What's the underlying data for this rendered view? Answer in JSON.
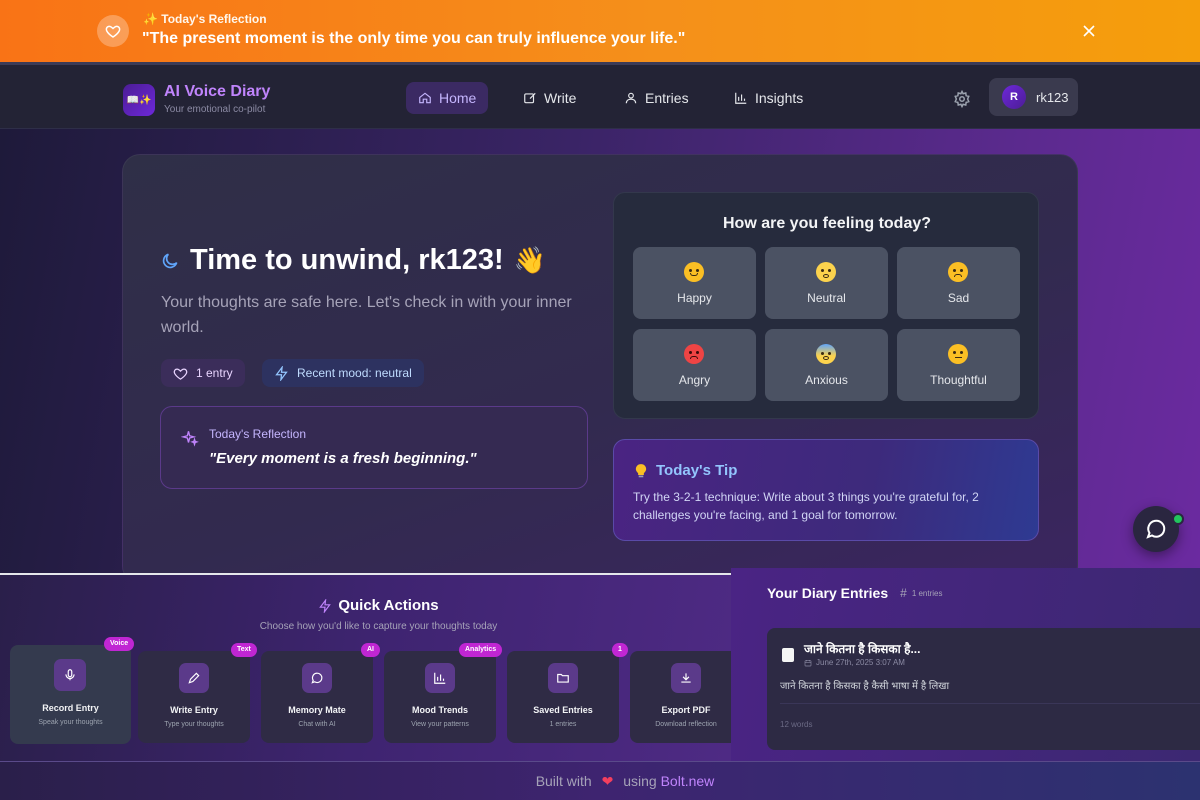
{
  "banner": {
    "label": "✨ Today's Reflection",
    "quote": "\"The present moment is the only time you can truly influence your life.\""
  },
  "nav": {
    "app_title": "AI Voice Diary",
    "app_subtitle": "Your emotional co-pilot",
    "items": [
      {
        "label": "Home",
        "icon": "home-icon"
      },
      {
        "label": "Write",
        "icon": "edit-icon"
      },
      {
        "label": "Entries",
        "icon": "user-icon"
      },
      {
        "label": "Insights",
        "icon": "chart-icon"
      }
    ],
    "user_initial": "R",
    "username": "rk123"
  },
  "hero": {
    "title": "Time to unwind, rk123!",
    "emoji": "👋",
    "subtitle": "Your thoughts are safe here. Let's check in with your inner world.",
    "entries_pill": "1 entry",
    "mood_pill": "Recent mood: neutral",
    "reflection_label": "Today's Reflection",
    "reflection_text": "\"Every moment is a fresh beginning.\""
  },
  "mood": {
    "title": "How are you feeling today?",
    "options": [
      {
        "label": "Happy",
        "color": "#fbbf24"
      },
      {
        "label": "Neutral",
        "color": "#fcd34d"
      },
      {
        "label": "Sad",
        "color": "#fbbf24"
      },
      {
        "label": "Angry",
        "color": "#ef4444"
      },
      {
        "label": "Anxious",
        "color": "#93c5fd"
      },
      {
        "label": "Thoughtful",
        "color": "#fbbf24"
      }
    ]
  },
  "tip": {
    "title": "Today's Tip",
    "text": "Try the 3-2-1 technique: Write about 3 things you're grateful for, 2 challenges you're facing, and 1 goal for tomorrow."
  },
  "quick_actions": {
    "title": "Quick Actions",
    "subtitle": "Choose how you'd like to capture your thoughts today",
    "cards": [
      {
        "name": "Record Entry",
        "desc": "Speak your thoughts",
        "badge": "Voice",
        "icon": "microphone-icon"
      },
      {
        "name": "Write Entry",
        "desc": "Type your thoughts",
        "badge": "Text",
        "icon": "pen-icon"
      },
      {
        "name": "Memory Mate",
        "desc": "Chat with AI",
        "badge": "AI",
        "icon": "chat-icon"
      },
      {
        "name": "Mood Trends",
        "desc": "View your patterns",
        "badge": "Analytics",
        "icon": "bar-chart-icon"
      },
      {
        "name": "Saved Entries",
        "desc": "1 entries",
        "badge": "1",
        "icon": "folder-icon"
      },
      {
        "name": "Export PDF",
        "desc": "Download reflection",
        "badge": "",
        "icon": "download-icon"
      }
    ]
  },
  "entries": {
    "title": "Your Diary Entries",
    "count": "1 entries",
    "items": [
      {
        "title": "जाने कितना है किसका है...",
        "date": "June 27th, 2025 3:07 AM",
        "body": "जाने कितना है किसका है कैसी भाषा में है लिखा",
        "words": "12 words"
      }
    ]
  },
  "footer": {
    "prefix": "Built with",
    "middle": "using",
    "brand": "Bolt.new"
  },
  "colors": {
    "banner_start": "#f97316",
    "banner_end": "#f59e0b",
    "accent": "#c084fc",
    "online": "#22c55e"
  }
}
